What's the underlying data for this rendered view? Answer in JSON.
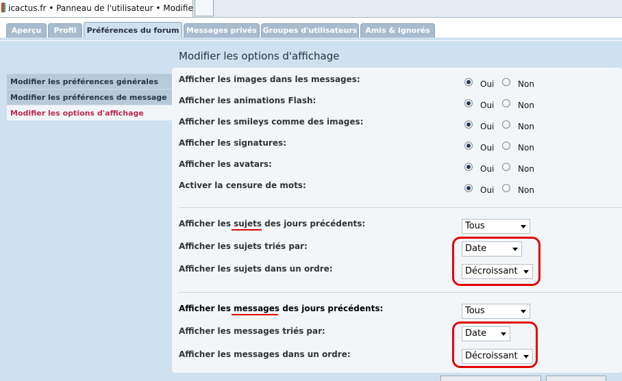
{
  "browser": {
    "tab_title": "icactus.fr • Panneau de l'utilisateur • Modifier les ..."
  },
  "tabs": [
    {
      "label": "Aperçu"
    },
    {
      "label": "Profil"
    },
    {
      "label": "Préférences du forum"
    },
    {
      "label": "Messages privés"
    },
    {
      "label": "Groupes d'utilisateurs"
    },
    {
      "label": "Amis & Ignorés"
    }
  ],
  "sidebar": {
    "items": [
      {
        "label": "Modifier les préférences générales"
      },
      {
        "label": "Modifier les préférences de message"
      },
      {
        "label": "Modifier les options d'affichage"
      }
    ]
  },
  "panel": {
    "title": "Modifier les options d'affichage"
  },
  "radio_rows": [
    {
      "label": "Afficher les images dans les messages:",
      "yes": "Oui",
      "no": "Non",
      "selected": "Oui"
    },
    {
      "label": "Afficher les animations Flash:",
      "yes": "Oui",
      "no": "Non",
      "selected": "Oui"
    },
    {
      "label": "Afficher les smileys comme des images:",
      "yes": "Oui",
      "no": "Non",
      "selected": "Oui"
    },
    {
      "label": "Afficher les signatures:",
      "yes": "Oui",
      "no": "Non",
      "selected": "Oui"
    },
    {
      "label": "Afficher les avatars:",
      "yes": "Oui",
      "no": "Non",
      "selected": "Oui"
    },
    {
      "label": "Activer la censure de mots:",
      "yes": "Oui",
      "no": "Non",
      "selected": "Oui"
    }
  ],
  "topics": {
    "days_label": {
      "pre": "Afficher les ",
      "hl": "sujets",
      "post": " des jours précédents:"
    },
    "days_value": "Tous",
    "sort_label": "Afficher les sujets triés par:",
    "sort_value": "Date",
    "order_label": "Afficher les sujets dans un ordre:",
    "order_value": "Décroissant"
  },
  "posts": {
    "days_label": {
      "pre": "Afficher les ",
      "hl": "messages",
      "post": " des jours précédents:"
    },
    "days_value": "Tous",
    "sort_label": "Afficher les messages triés par:",
    "sort_value": "Date",
    "order_label": "Afficher les messages dans un ordre:",
    "order_value": "Décroissant"
  },
  "colors": {
    "highlight": "#e20000",
    "active_link": "#bc2a4d"
  }
}
